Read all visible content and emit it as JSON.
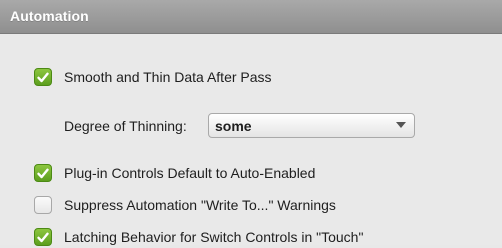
{
  "section": {
    "title": "Automation"
  },
  "options": {
    "smooth_thin": {
      "label": "Smooth and Thin Data After Pass",
      "checked": true
    },
    "degree_of_thinning": {
      "label": "Degree of Thinning:",
      "value": "some"
    },
    "plugin_controls": {
      "label": "Plug-in Controls Default to Auto-Enabled",
      "checked": true
    },
    "suppress_warnings": {
      "label": "Suppress Automation \"Write To...\" Warnings",
      "checked": false
    },
    "latching_behavior": {
      "label": "Latching Behavior for Switch Controls in \"Touch\"",
      "checked": true
    }
  },
  "colors": {
    "checkbox_checked": "#6fb12a",
    "header_bg": "#9a9a9a",
    "panel_bg": "#e9e9e9"
  }
}
